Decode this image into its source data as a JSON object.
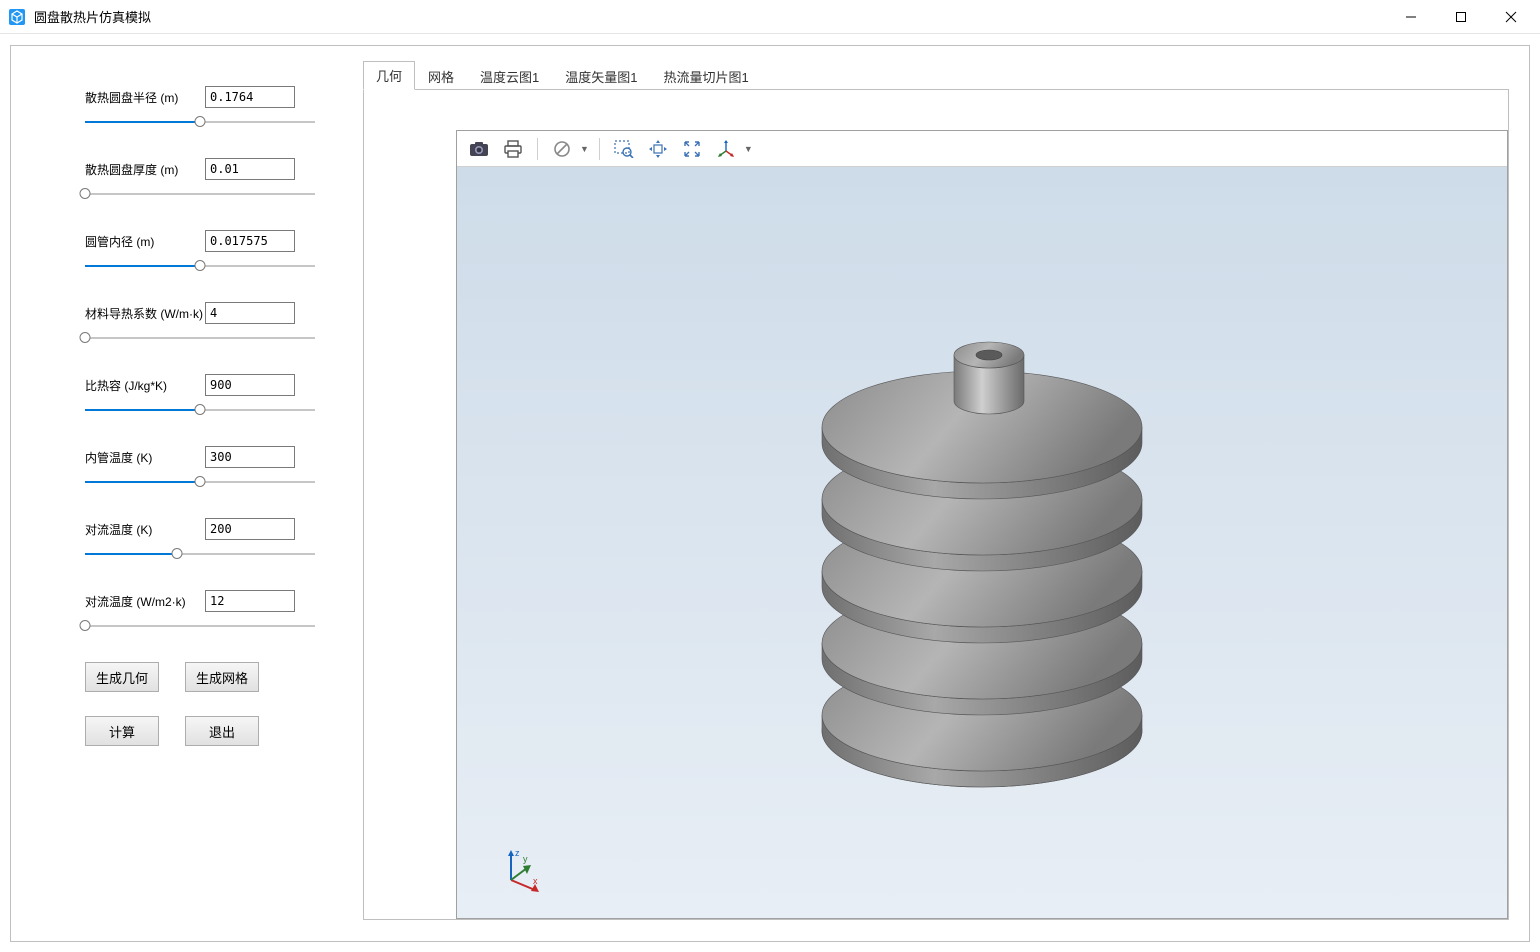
{
  "window": {
    "title": "圆盘散热片仿真模拟"
  },
  "params": [
    {
      "label": "散热圆盘半径 (m)",
      "value": "0.1764",
      "fill": 50
    },
    {
      "label": "散热圆盘厚度 (m)",
      "value": "0.01",
      "fill": 0
    },
    {
      "label": "圆管内径 (m)",
      "value": "0.017575",
      "fill": 50
    },
    {
      "label": "材料导热系数 (W/m·k)",
      "value": "4",
      "fill": 0
    },
    {
      "label": "比热容 (J/kg*K)",
      "value": "900",
      "fill": 50
    },
    {
      "label": "内管温度 (K)",
      "value": "300",
      "fill": 50
    },
    {
      "label": "对流温度 (K)",
      "value": "200",
      "fill": 40
    },
    {
      "label": "对流温度 (W/m2·k)",
      "value": "12",
      "fill": 0
    }
  ],
  "buttons": {
    "gen_geom": "生成几何",
    "gen_mesh": "生成网格",
    "compute": "计算",
    "exit": "退出"
  },
  "tabs": [
    {
      "label": "几何",
      "active": true
    },
    {
      "label": "网格",
      "active": false
    },
    {
      "label": "温度云图1",
      "active": false
    },
    {
      "label": "温度矢量图1",
      "active": false
    },
    {
      "label": "热流量切片图1",
      "active": false
    }
  ],
  "axis": {
    "x": "x",
    "y": "y",
    "z": "z"
  }
}
